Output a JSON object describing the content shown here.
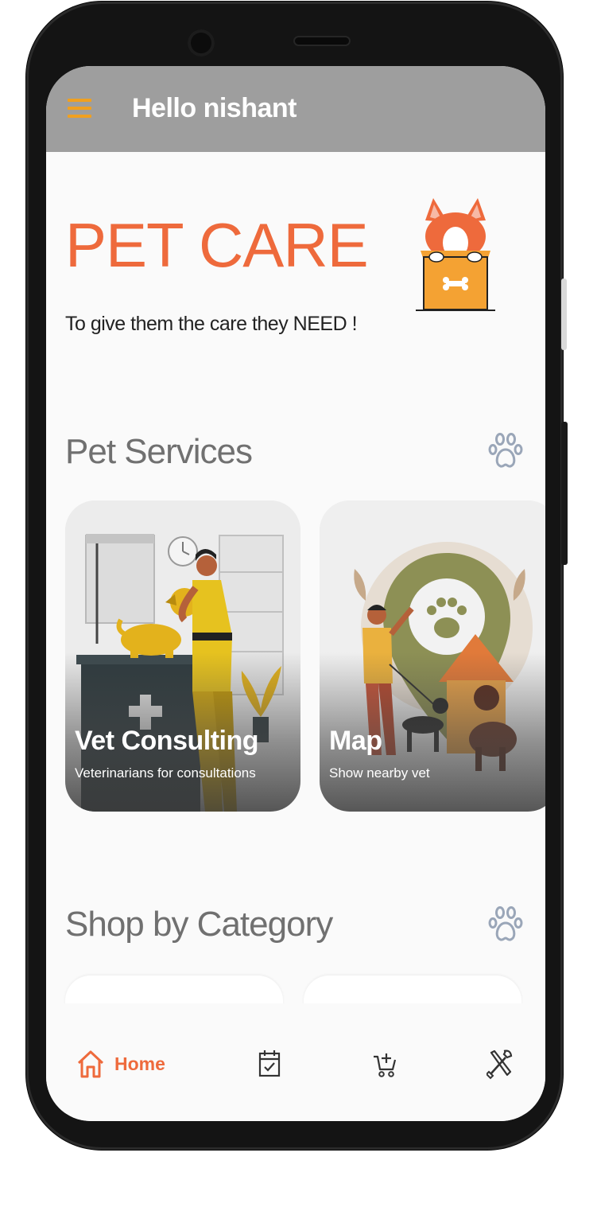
{
  "appbar": {
    "greeting": "Hello nishant",
    "menu_icon": "hamburger-menu-icon"
  },
  "hero": {
    "title": "PET CARE",
    "subtitle": "To give them the care they NEED !",
    "illustration": "dog-in-box-icon"
  },
  "services": {
    "heading": "Pet Services",
    "icon": "paw-icon",
    "cards": [
      {
        "title": "Vet Consulting",
        "subtitle": "Veterinarians for consultations"
      },
      {
        "title": "Map",
        "subtitle": "Show nearby vet"
      }
    ]
  },
  "shop": {
    "heading": "Shop by Category",
    "icon": "paw-icon"
  },
  "bottom_nav": {
    "items": [
      {
        "label": "Home",
        "icon": "home-icon",
        "active": true
      },
      {
        "label": "",
        "icon": "calendar-check-icon"
      },
      {
        "label": "",
        "icon": "cart-add-icon"
      },
      {
        "label": "",
        "icon": "tools-icon"
      }
    ]
  },
  "colors": {
    "accent": "#ee6a3c",
    "appbar": "#9e9e9e",
    "menu": "#f0a020",
    "heading": "#707070"
  }
}
